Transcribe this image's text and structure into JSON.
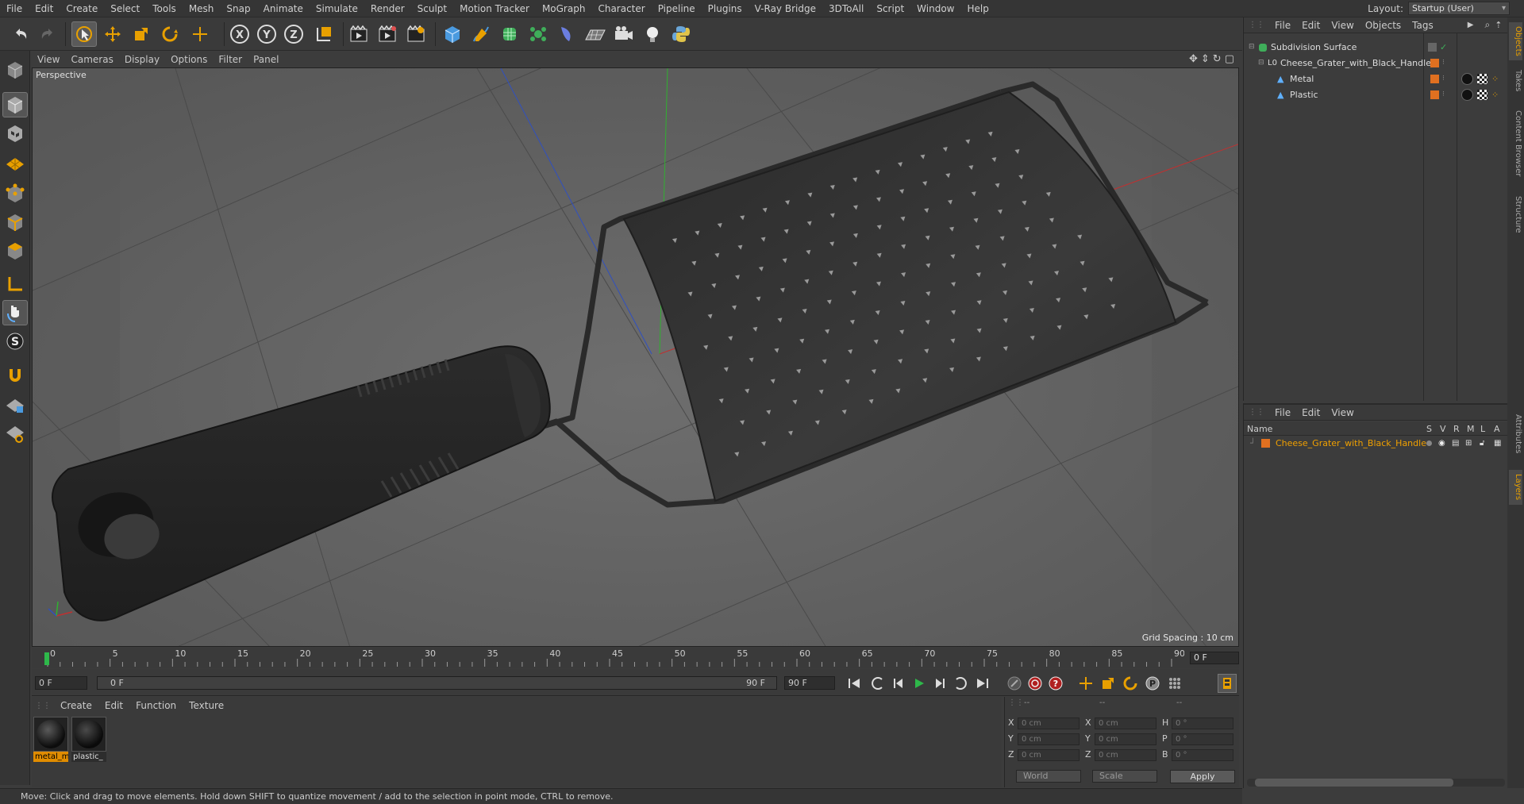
{
  "menubar": {
    "items": [
      "File",
      "Edit",
      "Create",
      "Select",
      "Tools",
      "Mesh",
      "Snap",
      "Animate",
      "Simulate",
      "Render",
      "Sculpt",
      "Motion Tracker",
      "MoGraph",
      "Character",
      "Pipeline",
      "Plugins",
      "V-Ray Bridge",
      "3DToAll",
      "Script",
      "Window",
      "Help"
    ],
    "layout_label": "Layout:",
    "layout_value": "Startup (User)"
  },
  "viewport": {
    "menu": [
      "View",
      "Cameras",
      "Display",
      "Options",
      "Filter",
      "Panel"
    ],
    "camera_label": "Perspective",
    "grid_spacing": "Grid Spacing : 10 cm"
  },
  "timeline": {
    "ticks": [
      "0",
      "5",
      "10",
      "15",
      "20",
      "25",
      "30",
      "35",
      "40",
      "45",
      "50",
      "55",
      "60",
      "65",
      "70",
      "75",
      "80",
      "85",
      "90"
    ],
    "current_frame": "0 F",
    "start_field": "0 F",
    "range_start": "0 F",
    "range_end": "90 F",
    "end_field": "90 F"
  },
  "materials": {
    "menu": [
      "Create",
      "Edit",
      "Function",
      "Texture"
    ],
    "items": [
      {
        "name": "metal_m",
        "selected": true
      },
      {
        "name": "plastic_",
        "selected": false
      }
    ]
  },
  "coordinates": {
    "headers": [
      "--",
      "--",
      "--"
    ],
    "rows": [
      {
        "l1": "X",
        "v1": "0 cm",
        "l2": "X",
        "v2": "0 cm",
        "l3": "H",
        "v3": "0 °"
      },
      {
        "l1": "Y",
        "v1": "0 cm",
        "l2": "Y",
        "v2": "0 cm",
        "l3": "P",
        "v3": "0 °"
      },
      {
        "l1": "Z",
        "v1": "0 cm",
        "l2": "Z",
        "v2": "0 cm",
        "l3": "B",
        "v3": "0 °"
      }
    ],
    "space": "World",
    "mode": "Scale",
    "apply": "Apply"
  },
  "status": "Move: Click and drag to move elements. Hold down SHIFT to quantize movement / add to the selection in point mode, CTRL to remove.",
  "object_manager": {
    "menu": [
      "File",
      "Edit",
      "View",
      "Objects",
      "Tags"
    ],
    "objects": [
      {
        "name": "Subdivision Surface"
      },
      {
        "name": "Cheese_Grater_with_Black_Handle"
      },
      {
        "name": "Metal"
      },
      {
        "name": "Plastic"
      }
    ]
  },
  "layer_manager": {
    "menu": [
      "File",
      "Edit",
      "View"
    ],
    "header_name": "Name",
    "header_flags": [
      "S",
      "V",
      "R",
      "M",
      "L",
      "A"
    ],
    "layer_name": "Cheese_Grater_with_Black_Handle"
  },
  "right_tabs": [
    "Objects",
    "Takes",
    "Content Browser",
    "Structure",
    "Attributes",
    "Layers"
  ],
  "colors": {
    "accent": "#e8a000",
    "layer_text": "#f0a000",
    "selection": "#e08c00"
  }
}
